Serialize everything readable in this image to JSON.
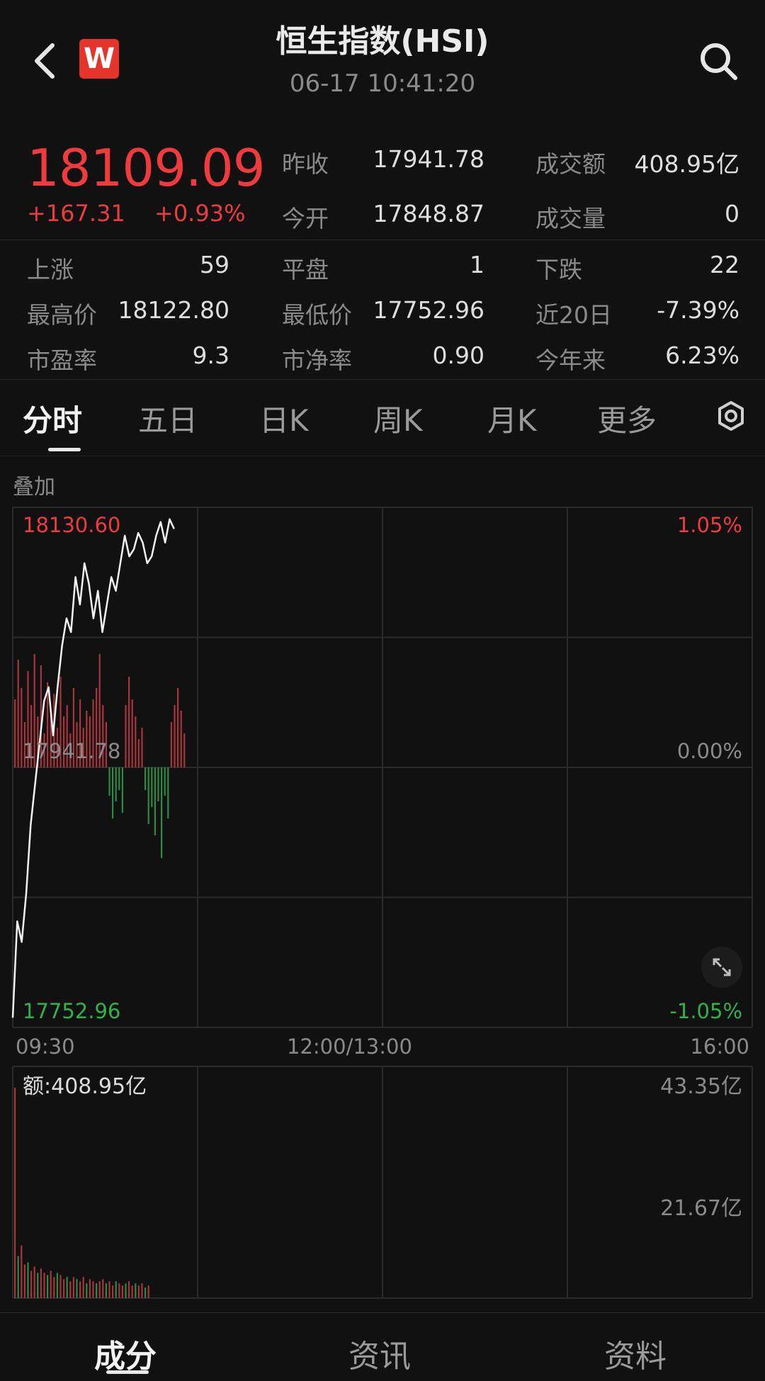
{
  "header": {
    "title": "恒生指数(HSI)",
    "datetime": "06-17 10:41:20",
    "logo_text": "W",
    "back_icon": "chevron-left-icon",
    "search_icon": "search-icon"
  },
  "quote": {
    "price": "18109.09",
    "change": "+167.31",
    "change_pct": "+0.93%"
  },
  "stats": [
    {
      "label": "昨收",
      "value": "17941.78"
    },
    {
      "label": "成交额",
      "value": "408.95亿"
    },
    {
      "label": "今开",
      "value": "17848.87"
    },
    {
      "label": "成交量",
      "value": "0"
    },
    {
      "label": "上涨",
      "value": "59"
    },
    {
      "label": "平盘",
      "value": "1"
    },
    {
      "label": "下跌",
      "value": "22"
    },
    {
      "label": "最高价",
      "value": "18122.80"
    },
    {
      "label": "最低价",
      "value": "17752.96"
    },
    {
      "label": "近20日",
      "value": "-7.39%"
    },
    {
      "label": "市盈率",
      "value": "9.3"
    },
    {
      "label": "市净率",
      "value": "0.90"
    },
    {
      "label": "今年来",
      "value": "6.23%"
    }
  ],
  "tabs": [
    "分时",
    "五日",
    "日K",
    "周K",
    "月K",
    "更多"
  ],
  "settings_icon": "settings-icon",
  "overlay_label": "叠加",
  "chart": {
    "high_label": "18130.60",
    "high_pct": "1.05%",
    "base_label": "17941.78",
    "base_pct": "0.00%",
    "low_label": "17752.96",
    "low_pct": "-1.05%",
    "times": [
      "09:30",
      "12:00/13:00",
      "16:00"
    ],
    "fullscreen_icon": "expand-icon"
  },
  "volume": {
    "amount_label": "额:408.95亿",
    "max_label": "43.35亿",
    "mid_label": "21.67亿"
  },
  "chart_data": {
    "type": "line",
    "ylim": [
      17752.96,
      18130.6
    ],
    "base": 17941.78,
    "x_minutes_elapsed": [
      0,
      2,
      4,
      6,
      8,
      10,
      12,
      14,
      16,
      18,
      20,
      22,
      24,
      26,
      28,
      30,
      32,
      34,
      36,
      38,
      40,
      42,
      44,
      46,
      48,
      50,
      52,
      54,
      56,
      58,
      60,
      62,
      64,
      66,
      68,
      70,
      72
    ],
    "price": [
      17760,
      17830,
      17815,
      17850,
      17900,
      17930,
      17960,
      17990,
      18000,
      17965,
      18000,
      18030,
      18050,
      18040,
      18080,
      18060,
      18090,
      18075,
      18050,
      18070,
      18040,
      18060,
      18080,
      18070,
      18090,
      18110,
      18095,
      18100,
      18112,
      18105,
      18090,
      18095,
      18110,
      18120,
      18105,
      18122,
      18115
    ],
    "breadth_bars": [
      60,
      95,
      70,
      40,
      85,
      55,
      100,
      45,
      90,
      30,
      75,
      50,
      65,
      35,
      80,
      45,
      55,
      30,
      70,
      40,
      60,
      35,
      50,
      45,
      60,
      70,
      100,
      55,
      40,
      -25,
      -45,
      -30,
      -20,
      -40,
      55,
      80,
      60,
      45,
      25,
      35,
      -20,
      -50,
      -35,
      -60,
      -30,
      -80,
      -25,
      -45,
      40,
      55,
      70,
      50,
      30
    ]
  },
  "volume_data": [
    1.0,
    0.2,
    0.25,
    0.16,
    0.17,
    0.13,
    0.15,
    0.12,
    0.14,
    0.12,
    0.11,
    0.13,
    0.1,
    0.12,
    0.11,
    0.09,
    0.1,
    0.08,
    0.1,
    0.09,
    0.08,
    0.1,
    0.07,
    0.09,
    0.08,
    0.07,
    0.08,
    0.09,
    0.07,
    0.08,
    0.06,
    0.08,
    0.07,
    0.06,
    0.07,
    0.08,
    0.06,
    0.07,
    0.06,
    0.07,
    0.05,
    0.06
  ],
  "bottom_nav": [
    "成分",
    "资讯",
    "资料"
  ]
}
